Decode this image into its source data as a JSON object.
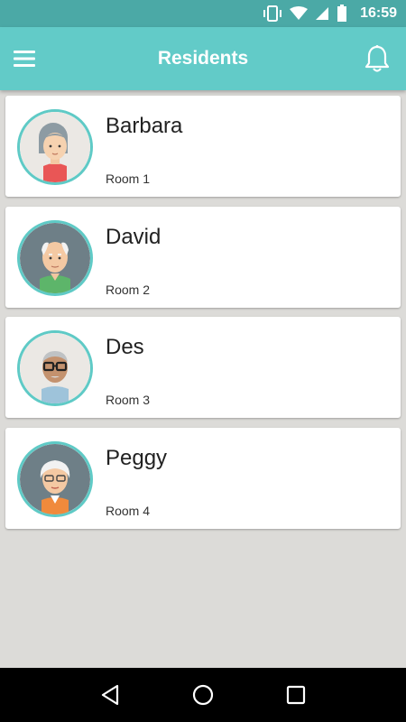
{
  "status_bar": {
    "time": "16:59",
    "icons": [
      "vibrate-icon",
      "wifi-icon",
      "cell-signal-icon",
      "battery-icon"
    ]
  },
  "app_bar": {
    "title": "Residents",
    "left_icon": "menu-icon",
    "right_icon": "bell-icon"
  },
  "residents": [
    {
      "name": "Barbara",
      "room": "Room 1"
    },
    {
      "name": "David",
      "room": "Room 2"
    },
    {
      "name": "Des",
      "room": "Room 3"
    },
    {
      "name": "Peggy",
      "room": "Room 4"
    }
  ],
  "nav_bar": {
    "icons": [
      "back-icon",
      "home-icon",
      "recents-icon"
    ]
  },
  "colors": {
    "status_bar": "#4ba9a6",
    "app_bar": "#62cbc8",
    "avatar_ring": "#5fcac6",
    "background": "#dcdbd8"
  }
}
